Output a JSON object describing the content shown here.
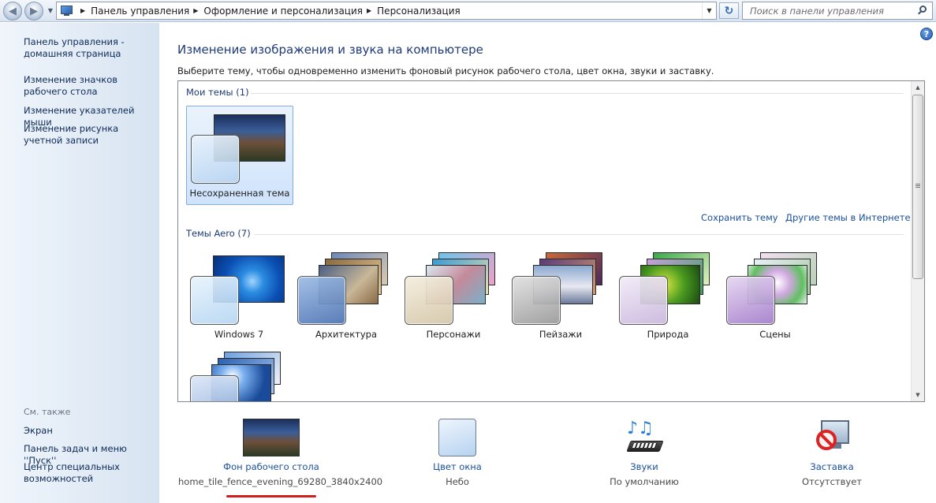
{
  "address_bar": {
    "crumbs": [
      "Панель управления",
      "Оформление и персонализация",
      "Персонализация"
    ],
    "search_placeholder": "Поиск в панели управления"
  },
  "sidebar": {
    "links": [
      "Панель управления - домашняя страница",
      "Изменение значков рабочего стола",
      "Изменение указателей мыши",
      "Изменение рисунка учетной записи"
    ],
    "see_also_label": "См. также",
    "see_also": [
      "Экран",
      "Панель задач и меню ''Пуск''",
      "Центр специальных возможностей"
    ]
  },
  "main": {
    "title": "Изменение изображения и звука на компьютере",
    "subtitle": "Выберите тему, чтобы одновременно изменить фоновый рисунок рабочего стола, цвет окна, звуки и заставку.",
    "my_themes": {
      "title": "Мои темы (1)",
      "items": [
        {
          "label": "Несохраненная тема",
          "selected": true
        }
      ]
    },
    "save_theme": "Сохранить тему",
    "more_themes": "Другие темы в Интернете",
    "aero_themes": {
      "title": "Темы Aero (7)",
      "items": [
        {
          "label": "Windows 7"
        },
        {
          "label": "Архитектура"
        },
        {
          "label": "Персонажи"
        },
        {
          "label": "Пейзажи"
        },
        {
          "label": "Природа"
        },
        {
          "label": "Сцены"
        },
        {
          "label": ""
        }
      ]
    }
  },
  "settings": {
    "background": {
      "title": "Фон рабочего стола",
      "value": "home_tile_fence_evening_69280_3840x2400"
    },
    "color": {
      "title": "Цвет окна",
      "value": "Небо"
    },
    "sounds": {
      "title": "Звуки",
      "value": "По умолчанию"
    },
    "screensaver": {
      "title": "Заставка",
      "value": "Отсутствует"
    }
  },
  "colors": {
    "link": "#1a4f9c",
    "heading": "#1e3a78",
    "selection": "#cfe3fb",
    "highlight_underline": "#d21d1d"
  }
}
